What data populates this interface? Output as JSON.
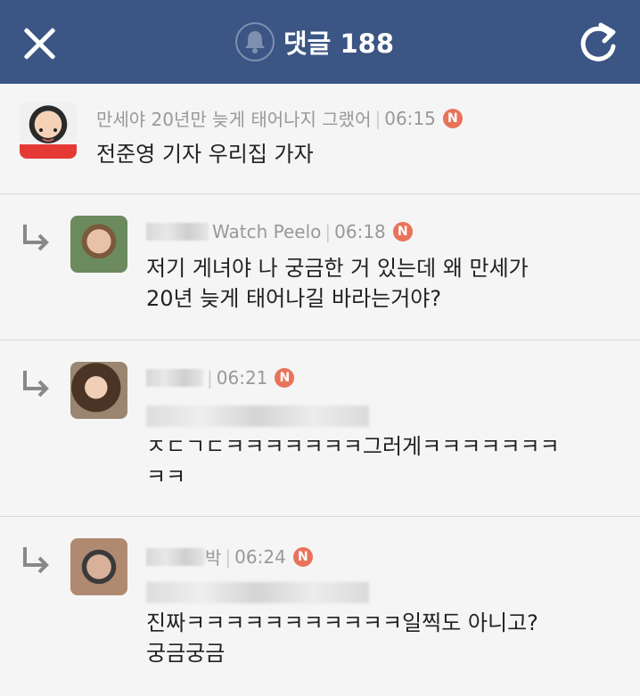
{
  "header": {
    "title": "댓글 188",
    "close_icon": "close-icon",
    "bell_icon": "bell-icon",
    "refresh_icon": "refresh-icon",
    "background": "#3b5584"
  },
  "comments": [
    {
      "author": "만세야 20년만 늦게 태어나지 그랬어",
      "time": "06:15",
      "badge": "N",
      "body": "전준영 기자 우리집 가자",
      "reply": false
    },
    {
      "author": "Watch Peelo",
      "time": "06:18",
      "badge": "N",
      "body": "저기 게녀야 나 궁금한 거 있는데 왜 만세가\n20년 늦게 태어나길 바라는거야?",
      "reply": true
    },
    {
      "author": "",
      "time": "06:21",
      "badge": "N",
      "mention": "Wat Peelo",
      "body": "ㅈㄷㄱㄷㅋㅋㅋㅋㅋㅋㅋ그러게ㅋㅋㅋㅋㅋㅋㅋ\nㅋㅋ",
      "reply": true
    },
    {
      "author": "박",
      "time": "06:24",
      "badge": "N",
      "mention": "Ferdi Peelo",
      "body": "진짜ㅋㅋㅋㅋㅋㅋㅋㅋㅋㅋㅋ일찍도 아니고?\n궁금궁금",
      "reply": true
    }
  ]
}
